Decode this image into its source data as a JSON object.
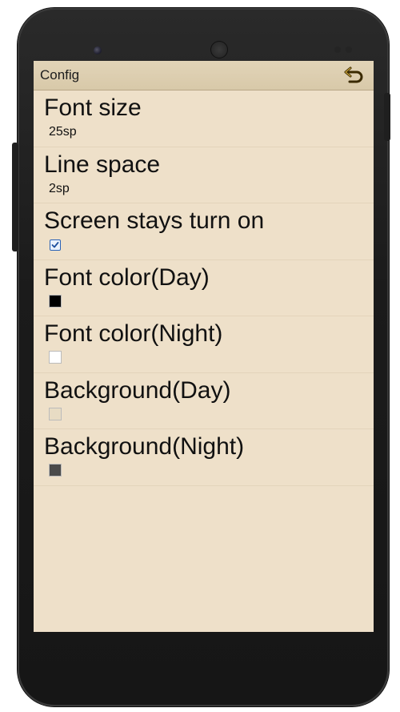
{
  "app": {
    "title": "Config"
  },
  "preferences": [
    {
      "title": "Font size",
      "summary": "25sp"
    },
    {
      "title": "Line space",
      "summary": "2sp"
    },
    {
      "title": "Screen stays turn on",
      "checked": true
    },
    {
      "title": "Font color(Day)",
      "color": "#000000"
    },
    {
      "title": "Font color(Night)",
      "color": "#ffffff"
    },
    {
      "title": "Background(Day)",
      "color": "#e8dcc4"
    },
    {
      "title": "Background(Night)",
      "color": "#4a4a4a"
    }
  ],
  "icons": {
    "back": "back-arrow-icon",
    "check": "checkmark-icon"
  },
  "theme": {
    "screen_bg": "#eee0c9",
    "action_bar_bg": "#d8c9a9",
    "accent": "#3a2a00"
  }
}
